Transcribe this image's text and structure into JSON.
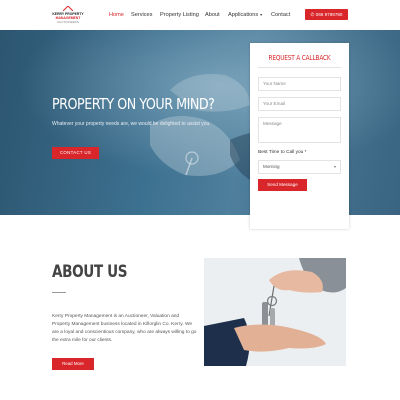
{
  "header": {
    "logo": {
      "line1": "KERRY PROPERTY",
      "line2": "MANAGEMENT",
      "line3": "AUCTIONEERS"
    },
    "nav": [
      {
        "label": "Home",
        "active": true,
        "dropdown": false
      },
      {
        "label": "Services",
        "active": false,
        "dropdown": false
      },
      {
        "label": "Property Listing",
        "active": false,
        "dropdown": false
      },
      {
        "label": "About",
        "active": false,
        "dropdown": false
      },
      {
        "label": "Applications",
        "active": false,
        "dropdown": true
      },
      {
        "label": "Contact",
        "active": false,
        "dropdown": false
      }
    ],
    "phone_label": "066 9789780",
    "phone_icon": "phone-icon"
  },
  "hero": {
    "title": "PROPERTY ON YOUR MIND?",
    "subtitle": "Whatever your property needs are, we would be delighted to assist you.",
    "button_label": "CONTACT US"
  },
  "callback_form": {
    "title": "REQUEST A CALLBACK",
    "name_placeholder": "Your Name",
    "email_placeholder": "Your Email",
    "message_placeholder": "Message",
    "time_label": "Best Time to Call you *",
    "time_selected": "Morning",
    "submit_label": "Send Message"
  },
  "about": {
    "title": "ABOUT US",
    "body": "Kerry Property Management is an Auctioneer, Valuation and Property Management business located in Killorglin Co. Kerry. We are a loyal and conscientious company, who are always willing to go the extra mile for our clients.",
    "button_label": "Read More"
  },
  "colors": {
    "accent": "#d9262b",
    "hero_bg": "#3d7190",
    "text": "#333333"
  }
}
